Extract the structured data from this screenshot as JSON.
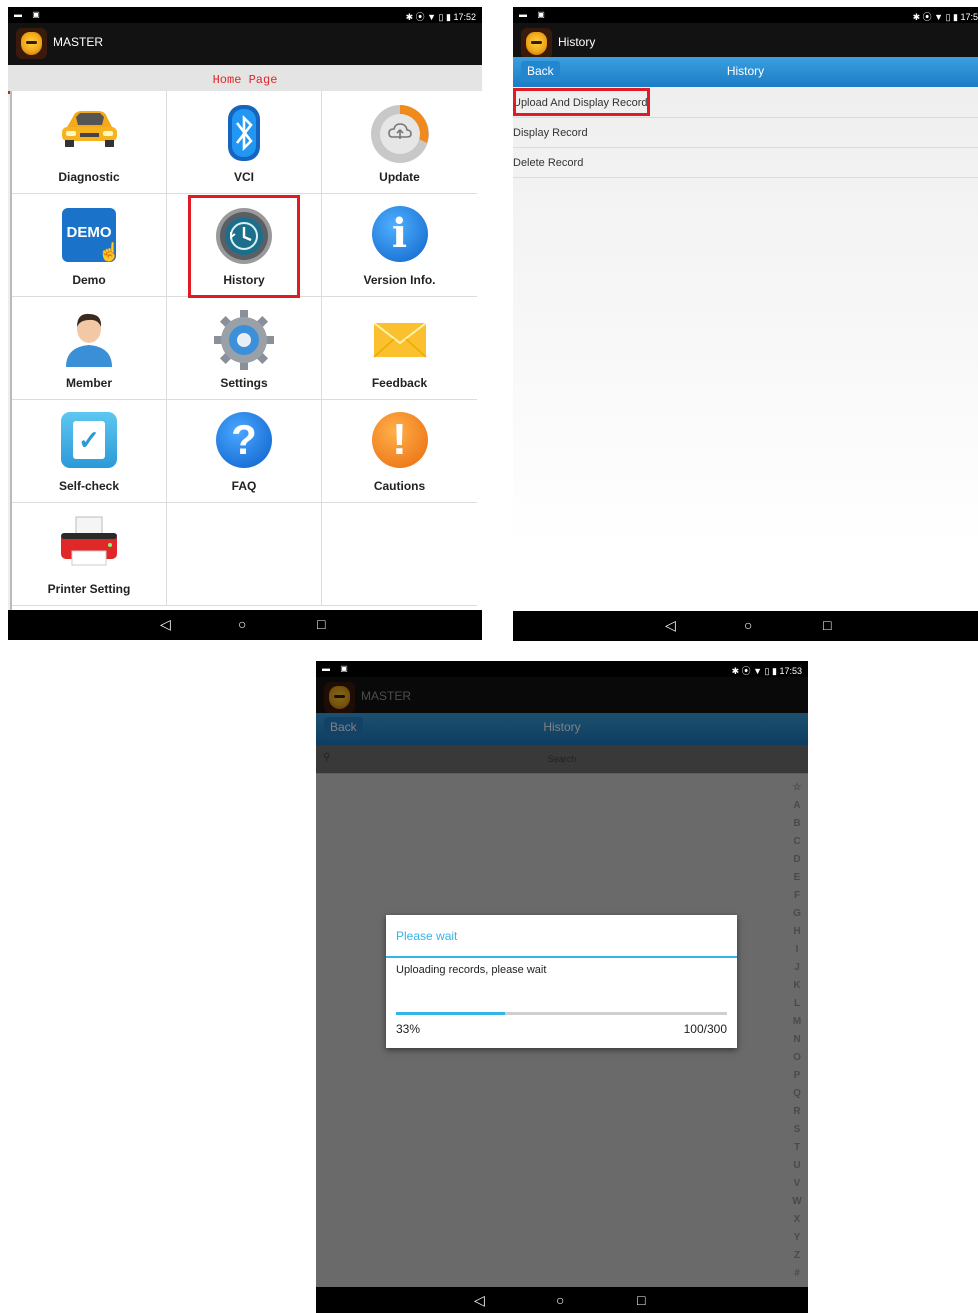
{
  "status": {
    "left_icons": "▬ ▣",
    "right_s1": "✱ ⦿ ▼ ▯ ▮ 17:52",
    "right_s2": "✱ ⦿ ▼ ▯ ▮ 17:5",
    "right_s3": "✱ ⦿ ▼ ▯ ▮ 17:53"
  },
  "nav": {
    "back": "◁",
    "home": "○",
    "recent": "□"
  },
  "screen1": {
    "app_title": "MASTER",
    "home_page": "Home Page",
    "tiles": [
      {
        "label": "Diagnostic",
        "icon": "car-icon"
      },
      {
        "label": "VCI",
        "icon": "bluetooth-icon"
      },
      {
        "label": "Update",
        "icon": "cloud-update-icon"
      },
      {
        "label": "Demo",
        "icon": "demo-icon",
        "badge": "DEMO"
      },
      {
        "label": "History",
        "icon": "history-clock-icon"
      },
      {
        "label": "Version Info.",
        "icon": "info-icon",
        "glyph": "i"
      },
      {
        "label": "Member",
        "icon": "person-icon"
      },
      {
        "label": "Settings",
        "icon": "gear-icon"
      },
      {
        "label": "Feedback",
        "icon": "envelope-icon"
      },
      {
        "label": "Self-check",
        "icon": "checklist-icon",
        "glyph": "✓"
      },
      {
        "label": "FAQ",
        "icon": "question-icon",
        "glyph": "?"
      },
      {
        "label": "Cautions",
        "icon": "exclamation-icon",
        "glyph": "!"
      },
      {
        "label": "Printer Setting",
        "icon": "printer-icon"
      }
    ]
  },
  "screen2": {
    "app_title": "History",
    "back": "Back",
    "title": "History",
    "items": [
      "Upload And Display Record",
      "Display Record",
      "Delete Record"
    ]
  },
  "screen3": {
    "app_title": "MASTER",
    "back": "Back",
    "title": "History",
    "search_placeholder": "Search",
    "alphabet": [
      "☆",
      "A",
      "B",
      "C",
      "D",
      "E",
      "F",
      "G",
      "H",
      "I",
      "J",
      "K",
      "L",
      "M",
      "N",
      "O",
      "P",
      "Q",
      "R",
      "S",
      "T",
      "U",
      "V",
      "W",
      "X",
      "Y",
      "Z",
      "#"
    ],
    "dialog": {
      "title": "Please wait",
      "message": "Uploading records, please wait",
      "percent_text": "33%",
      "count_text": "100/300",
      "progress": 0.33
    }
  },
  "colors": {
    "accent_blue": "#33b5e5",
    "highlight_red": "#e01b24",
    "home_red": "#e0262a"
  }
}
